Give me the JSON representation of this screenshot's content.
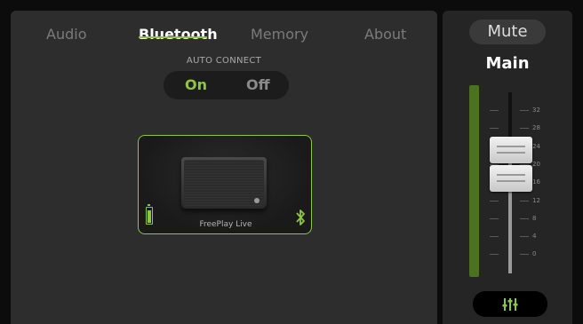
{
  "tabs": {
    "audio": "Audio",
    "bluetooth": "Bluetooth",
    "memory": "Memory",
    "about": "About",
    "active": "Bluetooth"
  },
  "auto_connect": {
    "label": "AUTO CONNECT",
    "on": "On",
    "off": "Off",
    "selected": "On"
  },
  "device": {
    "name": "FreePlay Live",
    "battery_icon": "battery-icon",
    "bluetooth_icon": "bluetooth-icon"
  },
  "mixer": {
    "mute_label": "Mute",
    "channel_label": "Main",
    "scale": [
      "32",
      "28",
      "24",
      "20",
      "16",
      "12",
      "8",
      "4",
      "0"
    ],
    "meter_level": 1.0,
    "eq_icon": "equalizer-icon"
  },
  "colors": {
    "accent": "#8dc63f",
    "panel": "#2d2d2d",
    "background": "#0c0c0c"
  }
}
